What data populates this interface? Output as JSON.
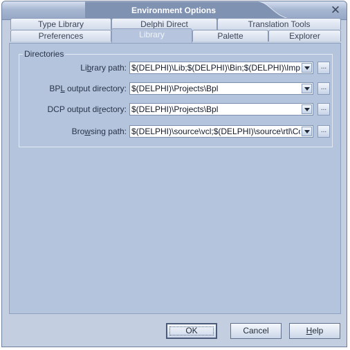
{
  "window": {
    "title": "Environment Options"
  },
  "tabs": {
    "back_row": [
      "Type Library",
      "Delphi Direct",
      "Translation Tools"
    ],
    "front_row": [
      "Preferences",
      "Library",
      "Palette",
      "Explorer"
    ],
    "active": "Library"
  },
  "directories": {
    "group_label": "Directories",
    "fields": [
      {
        "label_pre": "Li",
        "label_key": "b",
        "label_post": "rary path:",
        "value": "$(DELPHI)\\Lib;$(DELPHI)\\Bin;$(DELPHI)\\Impor"
      },
      {
        "label_pre": "BP",
        "label_key": "L",
        "label_post": " output directory:",
        "value": "$(DELPHI)\\Projects\\Bpl"
      },
      {
        "label_pre": "DCP output di",
        "label_key": "r",
        "label_post": "ectory:",
        "value": "$(DELPHI)\\Projects\\Bpl"
      },
      {
        "label_pre": "Bro",
        "label_key": "w",
        "label_post": "sing path:",
        "value": "$(DELPHI)\\source\\vcl;$(DELPHI)\\source\\rtl\\Co"
      }
    ],
    "browse_label": "..."
  },
  "buttons": {
    "ok": "OK",
    "cancel": "Cancel",
    "help_key": "H",
    "help_rest": "elp"
  },
  "icons": {
    "close": "close-icon",
    "dropdown": "chevron-down-icon"
  },
  "colors": {
    "titlebar": "#a7b7d2",
    "client": "#c3cfe1",
    "page": "#b4c4dc"
  }
}
